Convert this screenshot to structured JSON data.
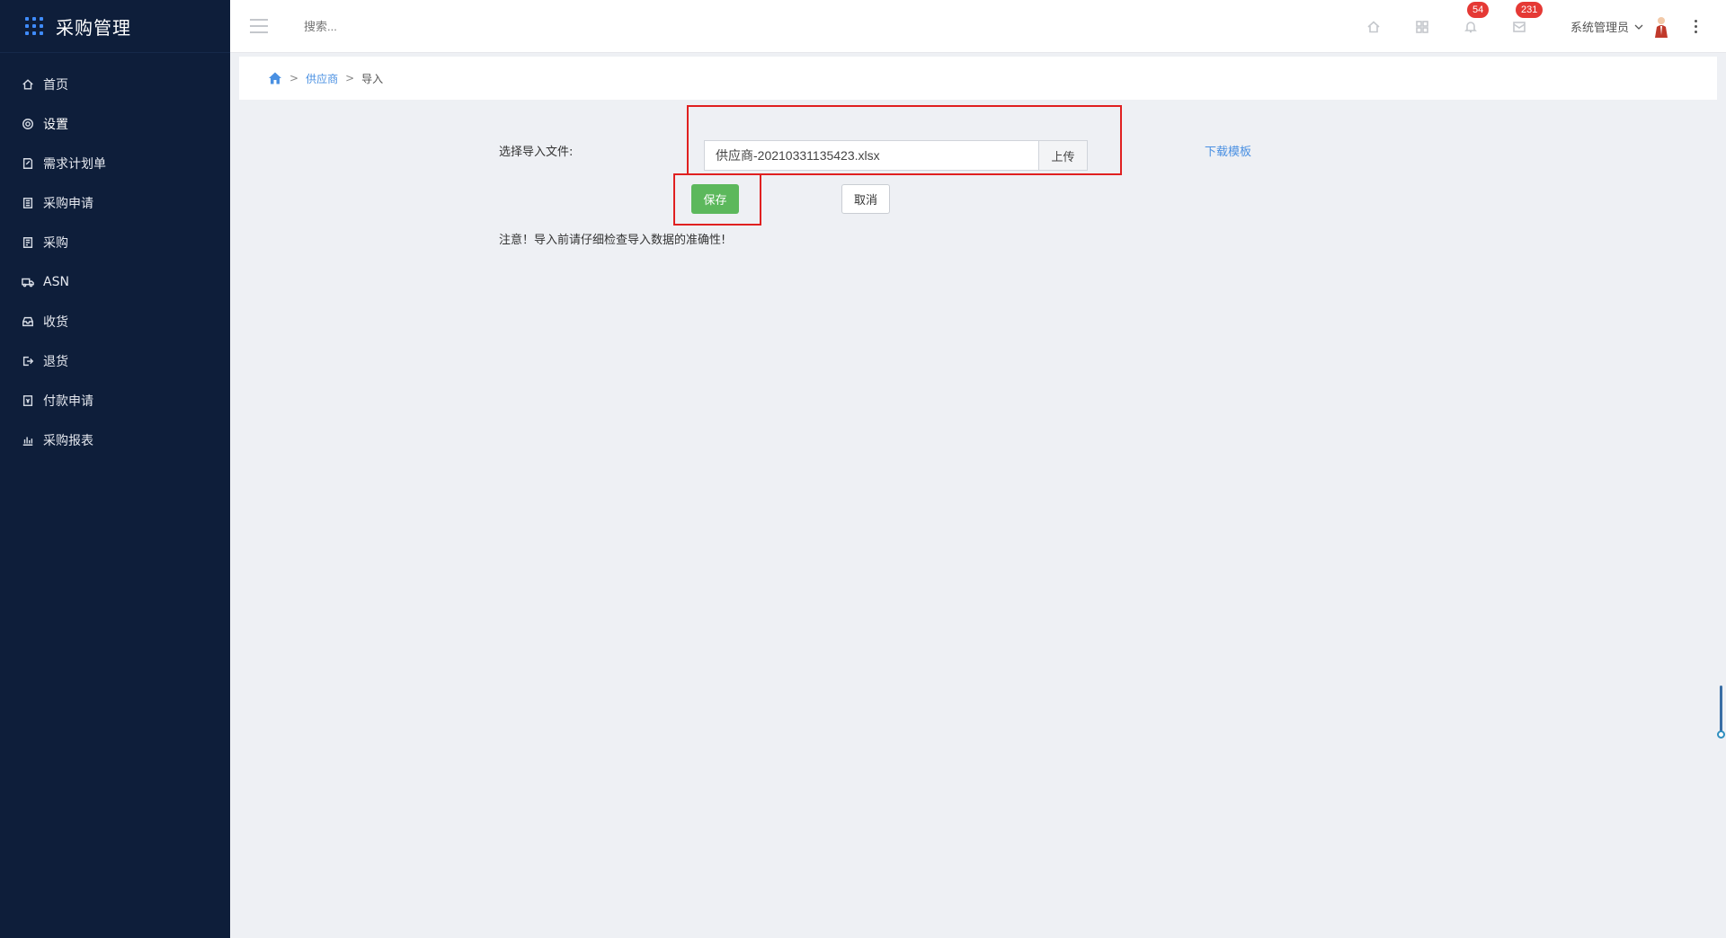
{
  "app": {
    "title": "采购管理",
    "brand_dot_colors": [
      "#4a90e2",
      "#4a90e2",
      "#4a90e2",
      "#4a90e2",
      "#4a90e2",
      "#4a90e2",
      "#4a90e2",
      "#4a90e2",
      "#4a90e2"
    ]
  },
  "sidebar": {
    "items": [
      {
        "label": "首页",
        "icon": "home-icon"
      },
      {
        "label": "设置",
        "icon": "gear-icon"
      },
      {
        "label": "需求计划单",
        "icon": "edit-document-icon"
      },
      {
        "label": "采购申请",
        "icon": "clipboard-icon"
      },
      {
        "label": "采购",
        "icon": "list-document-icon"
      },
      {
        "label": "ASN",
        "icon": "truck-icon"
      },
      {
        "label": "收货",
        "icon": "inbox-icon"
      },
      {
        "label": "退货",
        "icon": "sign-out-icon"
      },
      {
        "label": "付款申请",
        "icon": "payment-document-icon"
      },
      {
        "label": "采购报表",
        "icon": "bar-chart-icon"
      }
    ],
    "active_index": 1
  },
  "header": {
    "search_placeholder": "搜索...",
    "notifications_count": "54",
    "messages_count": "231",
    "user_name": "系统管理员"
  },
  "breadcrumb": {
    "link": "供应商",
    "current": "导入",
    "separator": ">"
  },
  "form": {
    "file_label": "选择导入文件:",
    "file_value": "供应商-20210331135423.xlsx",
    "upload_label": "上传",
    "download_template": "下载模板",
    "save_label": "保存",
    "cancel_label": "取消",
    "notice": "注意！导入前请仔细检查导入数据的准确性!"
  },
  "colors": {
    "sidebar_bg": "#0e1e3a",
    "accent_link": "#4a90e2",
    "save_green": "#5cb85c",
    "badge_red": "#e53935",
    "annotation_red": "#e02020"
  }
}
